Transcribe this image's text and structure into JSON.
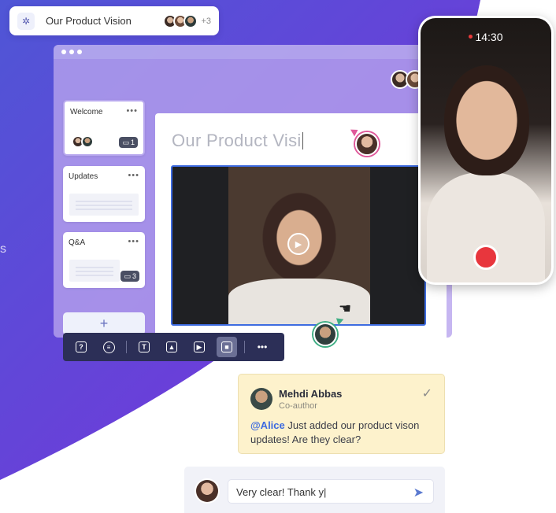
{
  "header": {
    "title": "Our Product Vision",
    "extra_collaborators": "+3"
  },
  "slides": [
    {
      "label": "Welcome",
      "comment_count": "1"
    },
    {
      "label": "Updates",
      "comment_count": ""
    },
    {
      "label": "Q&A",
      "comment_count": "3"
    }
  ],
  "add_slide": "+",
  "canvas": {
    "title": "Our Product Visi"
  },
  "phone": {
    "time": "14:30"
  },
  "comment": {
    "author": "Mehdi Abbas",
    "role": "Co-author",
    "mention": "@Alice",
    "text": " Just added our product vison updates! Are they clear?"
  },
  "reply": {
    "value": "Very clear! Thank y|"
  },
  "side_text": "s",
  "colors": {
    "brand_purple": "#5b46d9",
    "toolbar_bg": "#2c2f57",
    "selection_blue": "#3d6be0",
    "comment_bg": "#fdf2cc",
    "record_red": "#e8363d",
    "cursor_pink": "#e05a9b",
    "cursor_green": "#3fae84"
  },
  "icons": {
    "toolbar": [
      "question-icon",
      "chat-icon",
      "text-icon",
      "image-icon",
      "play-icon",
      "video-icon",
      "more-icon"
    ]
  }
}
